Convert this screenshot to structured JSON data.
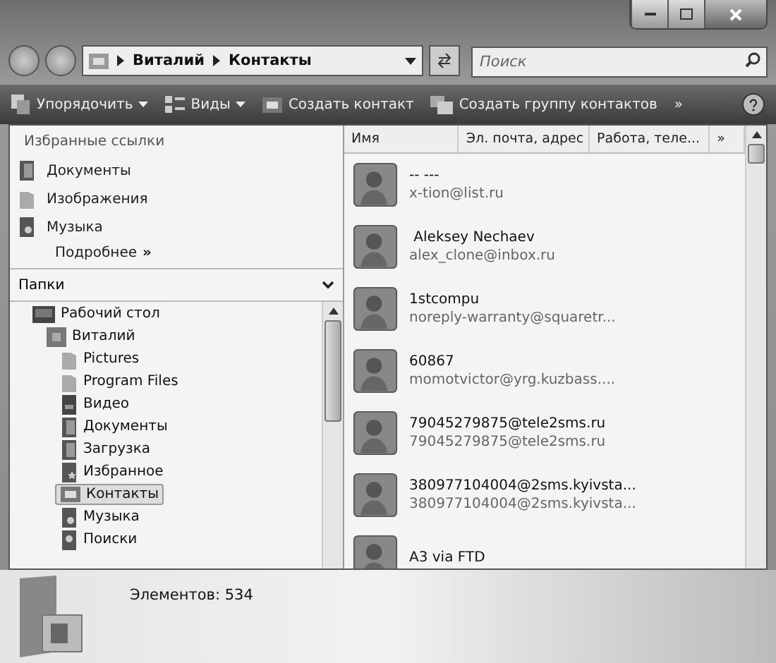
{
  "address": {
    "path": [
      "Виталий",
      "Контакты"
    ]
  },
  "search": {
    "placeholder": "Поиск"
  },
  "toolbar": [
    {
      "label": "Упорядочить",
      "kind": "organize",
      "dropdown": true
    },
    {
      "label": "Виды",
      "kind": "views",
      "dropdown": true
    },
    {
      "label": "Создать контакт",
      "kind": "contact",
      "dropdown": false
    },
    {
      "label": "Создать группу контактов",
      "kind": "group",
      "dropdown": false
    }
  ],
  "toolbar_more": "»",
  "favorites": {
    "title": "Избранные ссылки",
    "items": [
      {
        "label": "Документы",
        "kind": "doc"
      },
      {
        "label": "Изображения",
        "kind": "folder"
      },
      {
        "label": "Музыка",
        "kind": "music"
      }
    ],
    "more": "Подробнее",
    "more_mark": "»"
  },
  "folders": {
    "title": "Папки",
    "tree": [
      {
        "label": "Рабочий стол",
        "kind": "desktop",
        "selected": false,
        "children": [
          {
            "label": "Виталий",
            "kind": "user",
            "selected": false,
            "children": [
              {
                "label": "Pictures",
                "kind": "folder",
                "selected": false
              },
              {
                "label": "Program Files",
                "kind": "folder",
                "selected": false
              },
              {
                "label": "Видео",
                "kind": "video",
                "selected": false
              },
              {
                "label": "Документы",
                "kind": "doc",
                "selected": false
              },
              {
                "label": "Загрузка",
                "kind": "doc",
                "selected": false
              },
              {
                "label": "Избранное",
                "kind": "star",
                "selected": false
              },
              {
                "label": "Контакты",
                "kind": "contact",
                "selected": true
              },
              {
                "label": "Музыка",
                "kind": "music",
                "selected": false
              },
              {
                "label": "Поиски",
                "kind": "search",
                "selected": false
              }
            ]
          }
        ]
      }
    ]
  },
  "columns": [
    "Имя",
    "Эл. почта, адрес",
    "Работа, теле..."
  ],
  "columns_more": "»",
  "contacts": [
    {
      "name": "-- ---",
      "email": "x-tion@list.ru"
    },
    {
      "name": " Aleksey Nechaev",
      "email": "alex_clone@inbox.ru"
    },
    {
      "name": "1stcompu",
      "email": "noreply-warranty@squaretr..."
    },
    {
      "name": "60867",
      "email": "momotvictor@yrg.kuzbass...."
    },
    {
      "name": "79045279875@tele2sms.ru",
      "email": "79045279875@tele2sms.ru"
    },
    {
      "name": "380977104004@2sms.kyivsta...",
      "email": "380977104004@2sms.kyivsta..."
    },
    {
      "name": "A3 via FTD"
    }
  ],
  "status_bar": {
    "count": "Элементов: 534"
  }
}
